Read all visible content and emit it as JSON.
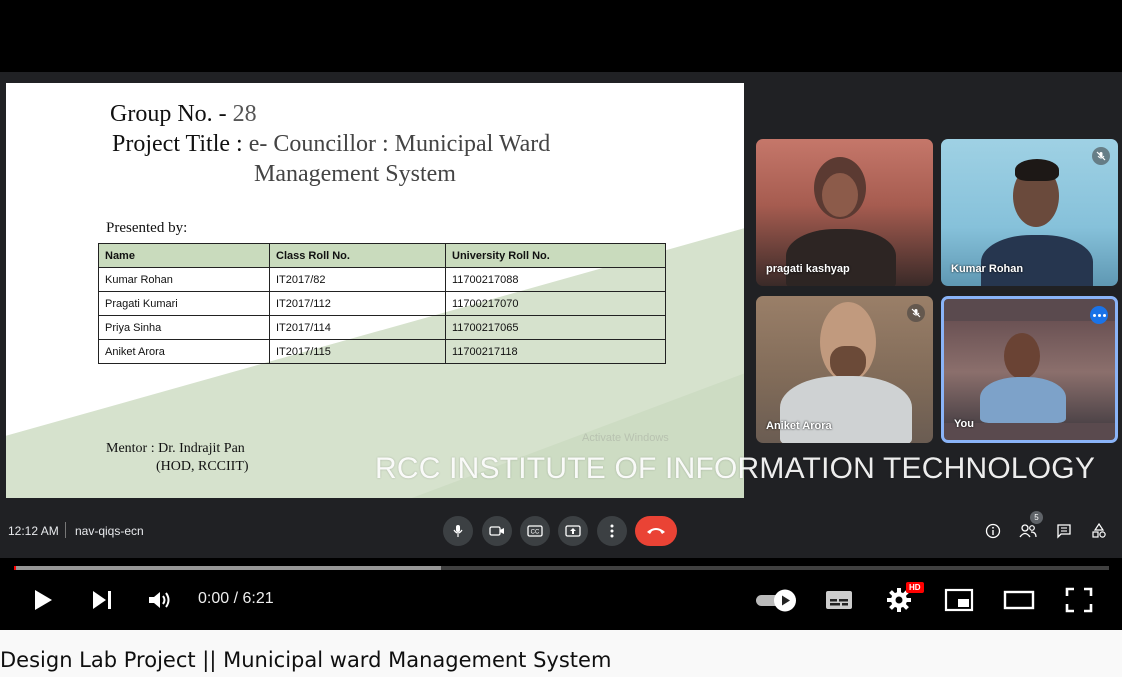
{
  "slide": {
    "group_label": "Group No. - ",
    "group_number": "28",
    "title_label": "Project Title : ",
    "title_line1": "e- Councillor : Municipal Ward",
    "title_line2": "Management System",
    "presented_by": "Presented by:",
    "table": {
      "headers": [
        "Name",
        "Class Roll No.",
        "University Roll No."
      ],
      "rows": [
        [
          "Kumar Rohan",
          "IT2017/82",
          "11700217088"
        ],
        [
          "Pragati Kumari",
          "IT2017/112",
          "11700217070"
        ],
        [
          "Priya Sinha",
          "IT2017/114",
          "11700217065"
        ],
        [
          "Aniket Arora",
          "IT2017/115",
          "11700217118"
        ]
      ]
    },
    "mentor_line1": "Mentor : Dr. Indrajit Pan",
    "mentor_line2": "(HOD, RCCIIT)",
    "activate_text": "Activate Windows"
  },
  "watermark": "RCC INSTITUTE OF INFORMATION TECHNOLOGY",
  "participants": [
    {
      "name": "pragati kashyap",
      "muted": false
    },
    {
      "name": "Kumar Rohan",
      "muted": true
    },
    {
      "name": "Aniket Arora",
      "muted": true
    },
    {
      "name": "You",
      "muted": false
    }
  ],
  "meet_bar": {
    "time": "12:12 AM",
    "meeting_code": "nav-qiqs-ecn",
    "participant_count": "5"
  },
  "player": {
    "time_display": "0:00 / 6:21",
    "progress_buffered": 0.39,
    "progress_played": 0.0,
    "hd_label": "HD"
  },
  "video_title": "Design Lab Project || Municipal ward Management System",
  "colors": {
    "meet_bg": "#202124",
    "end_call": "#ea4335",
    "active_tile_border": "#8ab4f8",
    "progress_red": "#ff0000"
  }
}
